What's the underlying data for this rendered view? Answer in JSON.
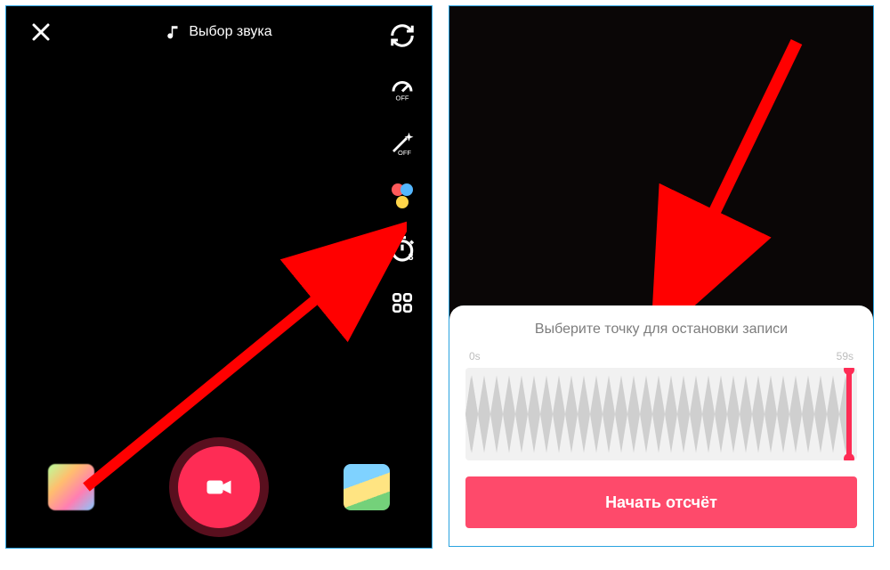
{
  "left": {
    "sound_label": "Выбор звука",
    "side_tools": {
      "flip": "flip",
      "speed": "speed",
      "beauty": "beauty",
      "filters": "filters",
      "timer": "timer",
      "more": "more"
    }
  },
  "right": {
    "panel_title": "Выберите точку для остановки записи",
    "start_label": "0s",
    "end_label": "59s",
    "start_button": "Начать отсчёт"
  },
  "colors": {
    "accent": "#fe2c55",
    "button": "#fe4a6b"
  }
}
